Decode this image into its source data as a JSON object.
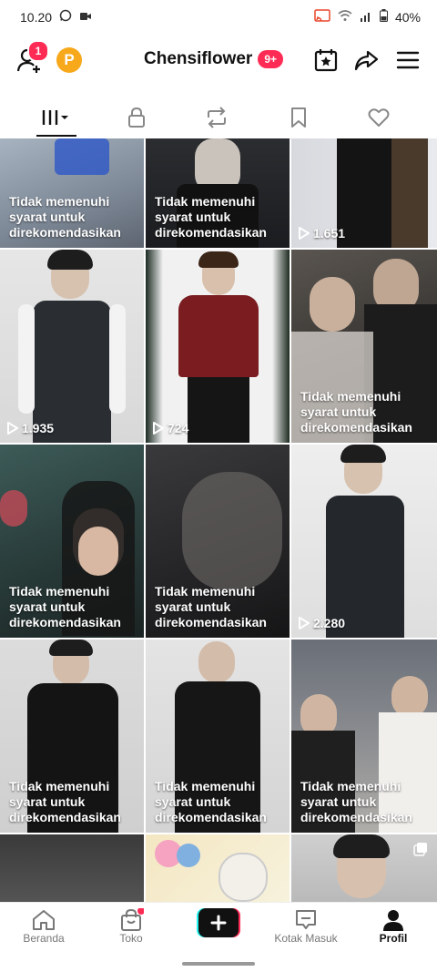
{
  "status_bar": {
    "time": "10.20",
    "battery": "40%"
  },
  "header": {
    "notification_count": "1",
    "coin_label": "P",
    "username": "Chensiflower",
    "username_badge": "9+"
  },
  "tabs": [
    {
      "name": "videos",
      "icon": "grid-icon"
    },
    {
      "name": "private",
      "icon": "lock-icon"
    },
    {
      "name": "reposts",
      "icon": "repost-icon"
    },
    {
      "name": "favorites",
      "icon": "bookmark-icon"
    },
    {
      "name": "liked",
      "icon": "heart-icon"
    }
  ],
  "not_recommended_text": "Tidak memenuhi syarat untuk direkomendasikan",
  "videos": [
    {
      "status": "restricted",
      "views": ""
    },
    {
      "status": "restricted",
      "views": ""
    },
    {
      "status": "public",
      "views": "1.651"
    },
    {
      "status": "public",
      "views": "1.935"
    },
    {
      "status": "public",
      "views": "724"
    },
    {
      "status": "restricted",
      "views": ""
    },
    {
      "status": "restricted",
      "views": ""
    },
    {
      "status": "restricted",
      "views": ""
    },
    {
      "status": "public",
      "views": "2.280"
    },
    {
      "status": "restricted",
      "views": ""
    },
    {
      "status": "restricted",
      "views": ""
    },
    {
      "status": "restricted",
      "views": ""
    }
  ],
  "bottom_nav": {
    "home": "Beranda",
    "shop": "Toko",
    "inbox": "Kotak Masuk",
    "profile": "Profil"
  },
  "colors": {
    "accent": "#fe2c55",
    "coin": "#f7a81b"
  }
}
